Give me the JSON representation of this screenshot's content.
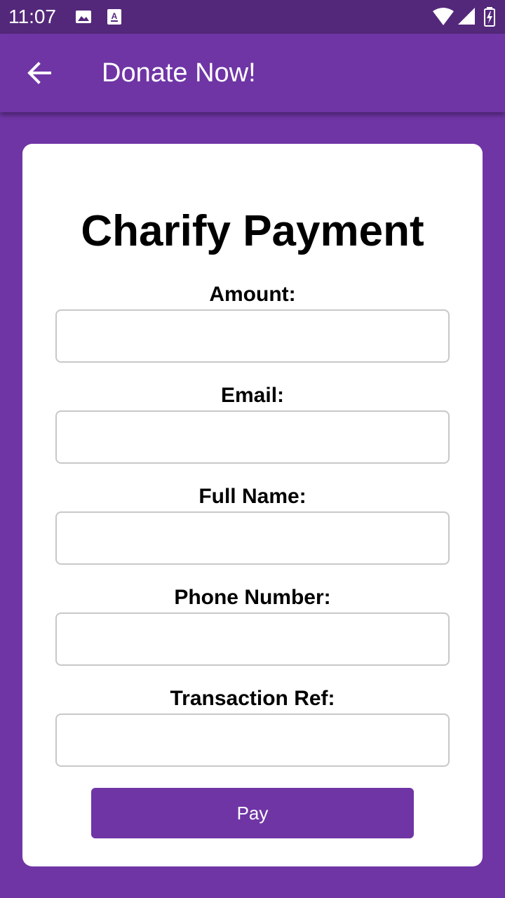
{
  "status_bar": {
    "time": "11:07",
    "icons": [
      "image-icon",
      "font-download-icon",
      "wifi-icon",
      "signal-icon",
      "battery-charging-icon"
    ]
  },
  "app_bar": {
    "back_icon": "arrow-left-icon",
    "title": "Donate Now!"
  },
  "form": {
    "title": "Charify Payment",
    "fields": [
      {
        "label": "Amount:",
        "value": ""
      },
      {
        "label": "Email:",
        "value": ""
      },
      {
        "label": "Full Name:",
        "value": ""
      },
      {
        "label": "Phone Number:",
        "value": ""
      },
      {
        "label": "Transaction Ref:",
        "value": ""
      }
    ],
    "submit_label": "Pay"
  },
  "colors": {
    "primary": "#6f35a5",
    "status_bar": "#53287a",
    "card": "#ffffff",
    "input_border": "#c8c8c8"
  }
}
